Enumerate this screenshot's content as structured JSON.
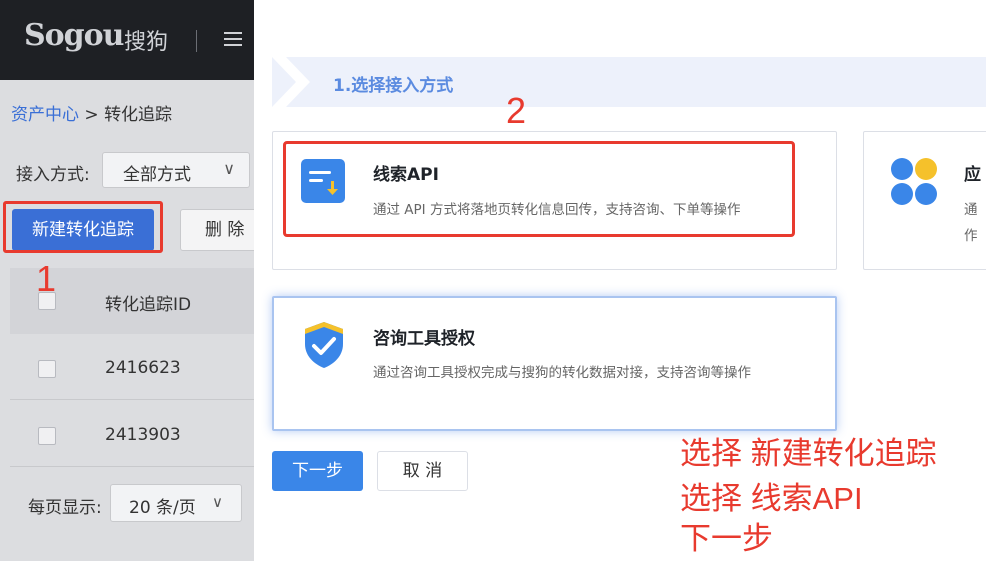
{
  "header": {
    "logo_text": "Sogou",
    "logo_cn": "搜狗"
  },
  "breadcrumb": {
    "root": "资产中心",
    "sep": " > ",
    "current": "转化追踪"
  },
  "filter": {
    "label": "接入方式:",
    "value": "全部方式"
  },
  "toolbar": {
    "create_label": "新建转化追踪",
    "delete_label": "删 除"
  },
  "table": {
    "header": "转化追踪ID",
    "rows": [
      {
        "id": "2416623"
      },
      {
        "id": "2413903"
      }
    ]
  },
  "pagination": {
    "label": "每页显示:",
    "value": "20 条/页"
  },
  "drawer": {
    "step_title": "1.选择接入方式",
    "cards": [
      {
        "title": "线索API",
        "desc": "通过 API 方式将落地页转化信息回传，支持咨询、下单等操作"
      },
      {
        "title": "应",
        "desc_line1": "通",
        "desc_line2": "作"
      },
      {
        "title": "咨询工具授权",
        "desc": "通过咨询工具授权完成与搜狗的转化数据对接，支持咨询等操作"
      }
    ],
    "next_label": "下一步",
    "cancel_label": "取 消"
  },
  "annotations": {
    "num1": "1",
    "num2": "2",
    "lines": [
      "选择 新建转化追踪",
      "选择 线索API",
      "下一步"
    ],
    "color": "#e83a2e"
  },
  "colors": {
    "primary": "#3a6fd6",
    "topbar": "#1e2024",
    "step_bg": "#edf1fb"
  }
}
